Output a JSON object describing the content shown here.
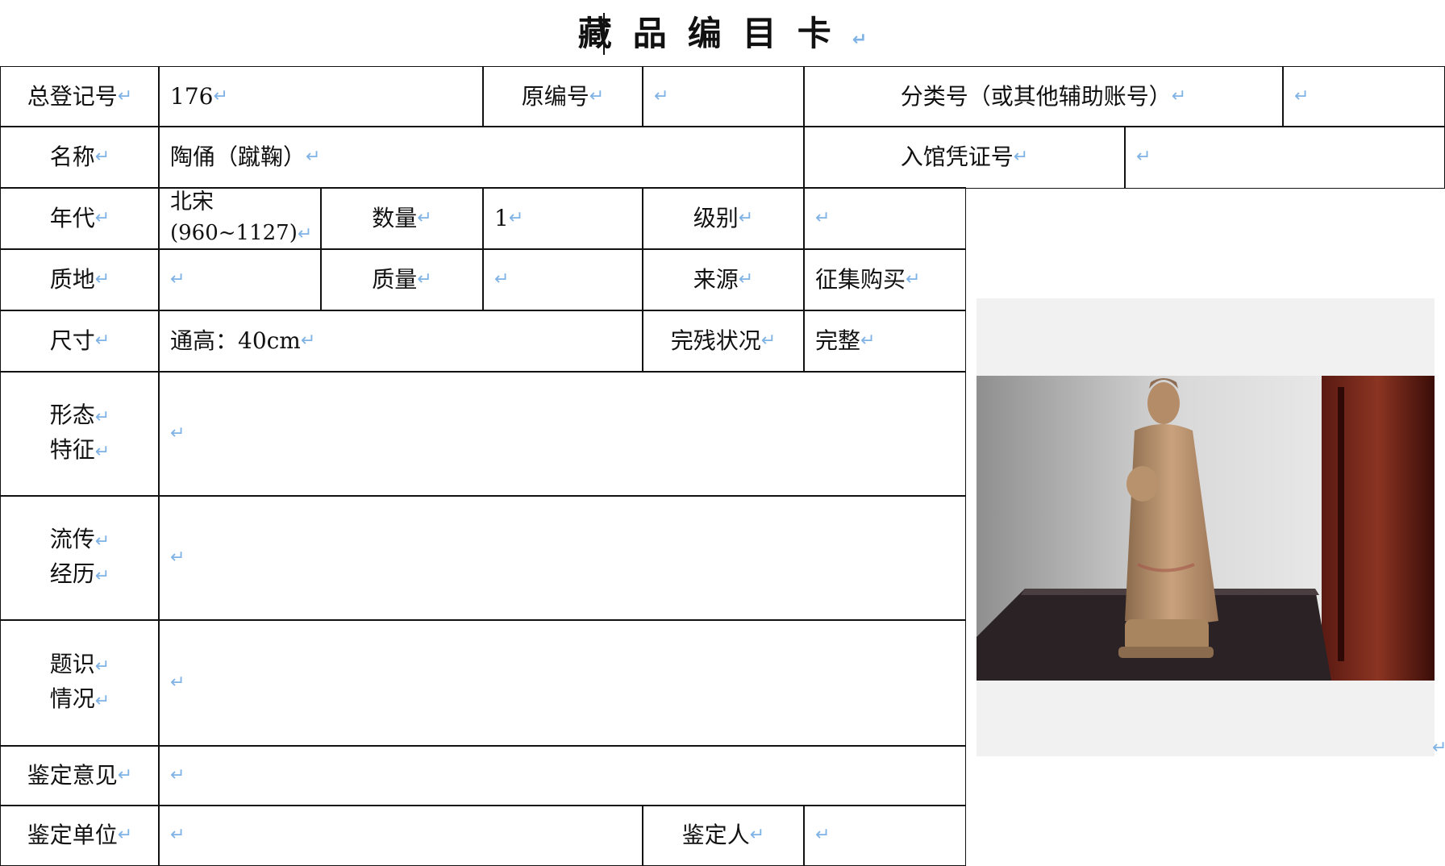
{
  "title": "藏品编目卡",
  "para_mark": "↵",
  "labels": {
    "registration_no": "总登记号",
    "original_no": "原编号",
    "category_no": "分类号（或其他辅助账号）",
    "name": "名称",
    "entry_voucher": "入馆凭证号",
    "era": "年代",
    "quantity": "数量",
    "grade": "级别",
    "material": "质地",
    "weight": "质量",
    "source": "来源",
    "size": "尺寸",
    "condition": "完残状况",
    "morphology_l1": "形态",
    "morphology_l2": "特征",
    "provenance_l1": "流传",
    "provenance_l2": "经历",
    "inscription_l1": "题识",
    "inscription_l2": "情况",
    "appraisal_opinion": "鉴定意见",
    "appraisal_unit": "鉴定单位",
    "appraiser": "鉴定人"
  },
  "values": {
    "registration_no": "176",
    "name": "陶俑（蹴鞠）",
    "era_l1": "北宋",
    "era_l2": "(960~1127)",
    "quantity": "1",
    "source": "征集购买",
    "size": "通高：40cm",
    "condition": "完整"
  },
  "colors": {
    "border": "#111111",
    "para_mark": "#7fb2e5",
    "photo_bg": "#f1f1f1"
  }
}
